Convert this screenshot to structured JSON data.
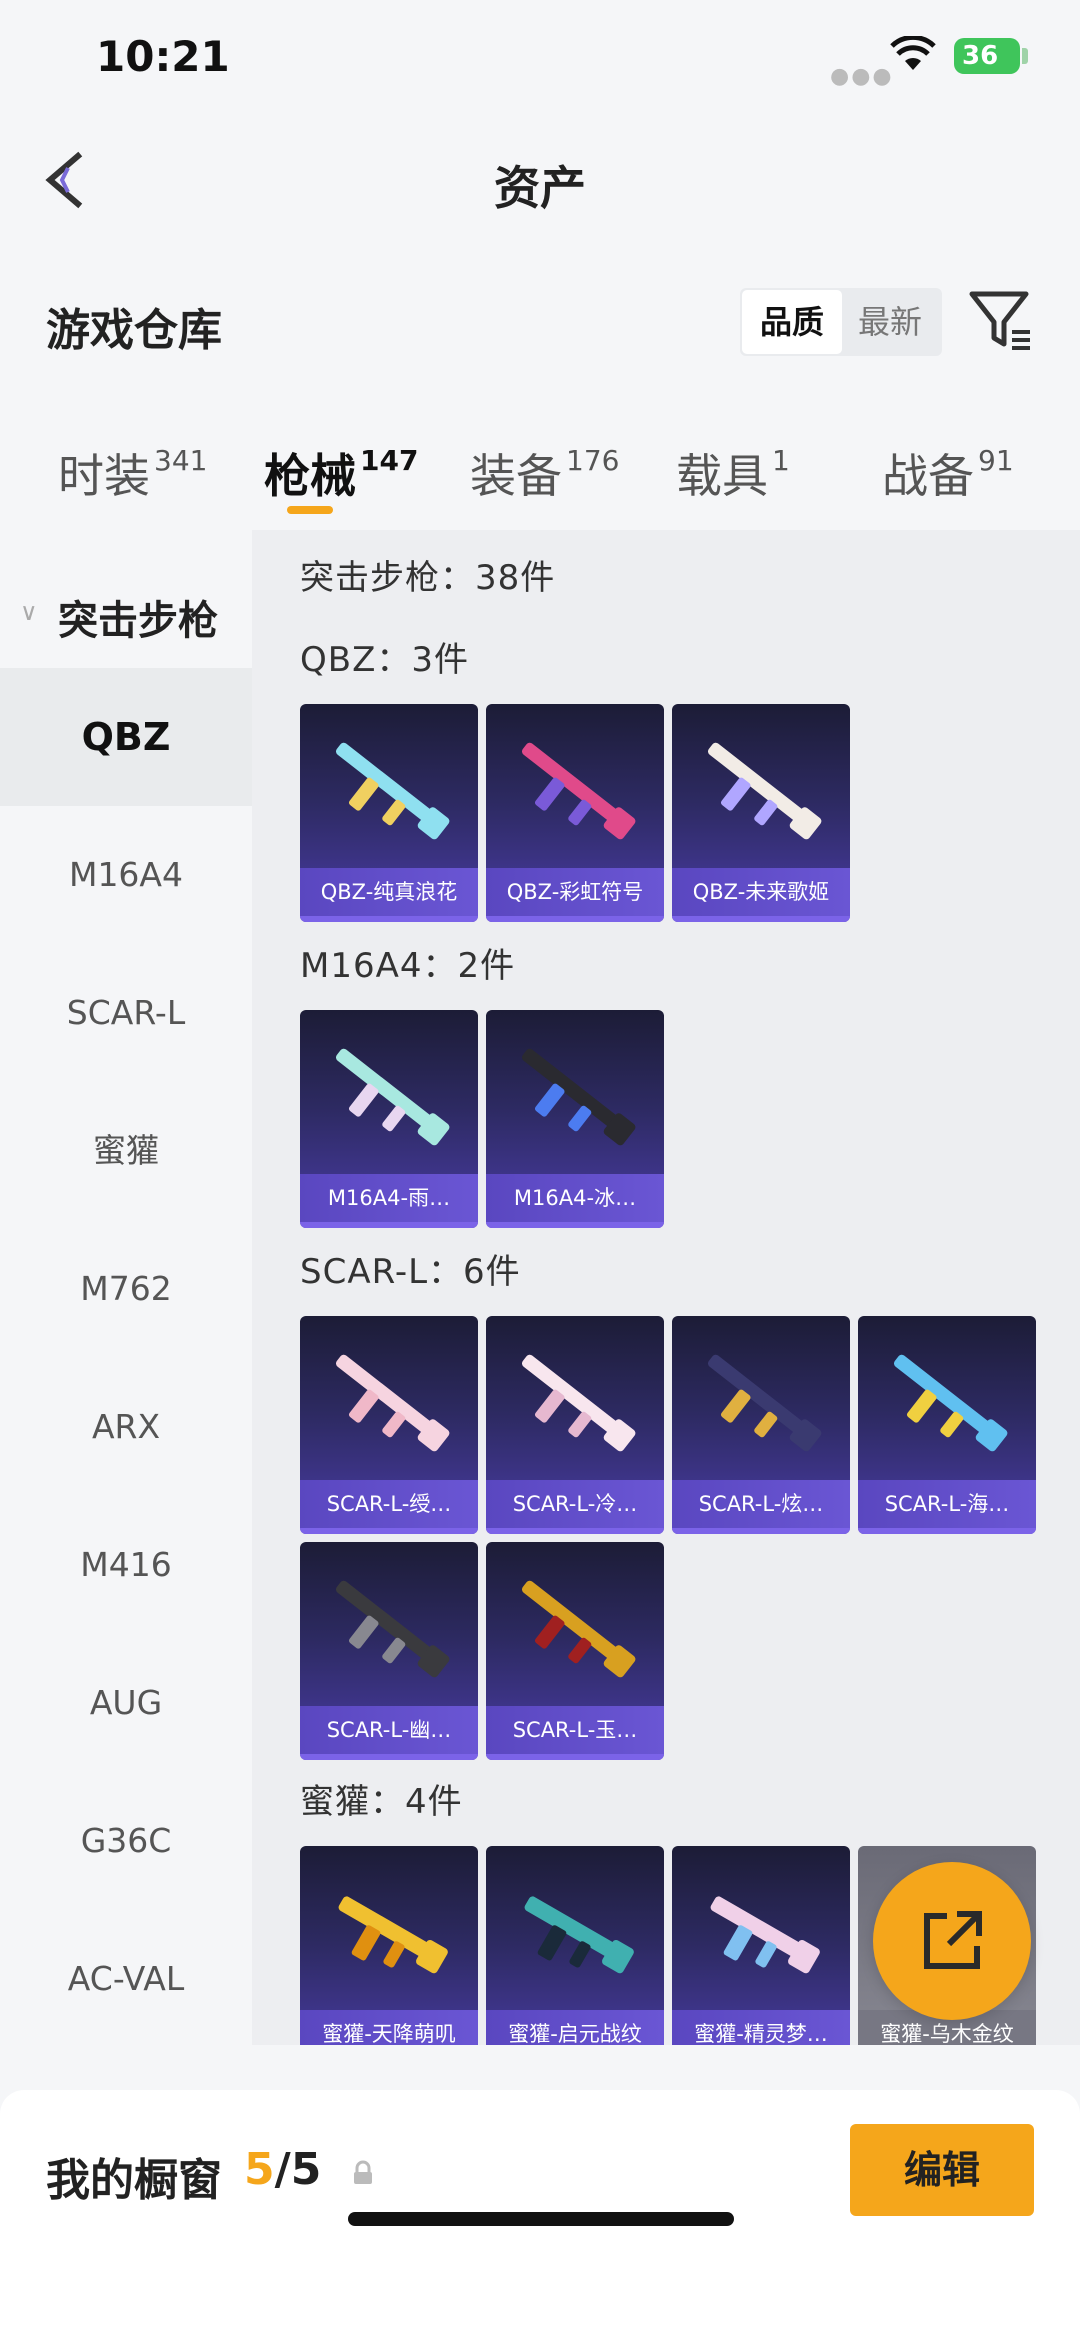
{
  "status": {
    "time": "10:21",
    "battery": "36"
  },
  "nav": {
    "title": "资产"
  },
  "header": {
    "title": "游戏仓库",
    "sort_options": [
      "品质",
      "最新"
    ],
    "sort_selected": "品质"
  },
  "tabs": [
    {
      "label": "时装",
      "count": "341",
      "active": false
    },
    {
      "label": "枪械",
      "count": "147",
      "active": true
    },
    {
      "label": "装备",
      "count": "176",
      "active": false
    },
    {
      "label": "载具",
      "count": "1",
      "active": false
    },
    {
      "label": "战备",
      "count": "91",
      "active": false
    }
  ],
  "sidebar": {
    "category": "突击步枪",
    "items": [
      "QBZ",
      "M16A4",
      "SCAR-L",
      "蜜獾",
      "M762",
      "ARX",
      "M416",
      "AUG",
      "G36C",
      "AC-VAL"
    ],
    "selected": "QBZ"
  },
  "content": {
    "summary": "突击步枪：38件",
    "groups": [
      {
        "title": "QBZ：3件",
        "items": [
          {
            "name": "QBZ-纯真浪花",
            "c1": "#8fe0f0",
            "c2": "#f0d060"
          },
          {
            "name": "QBZ-彩虹符号",
            "c1": "#e04a8a",
            "c2": "#7a5ad8"
          },
          {
            "name": "QBZ-未来歌姬",
            "c1": "#f2ece6",
            "c2": "#b0a6ff"
          }
        ]
      },
      {
        "title": "M16A4：2件",
        "items": [
          {
            "name": "M16A4-雨…",
            "c1": "#a8e8e0",
            "c2": "#e8d6f0"
          },
          {
            "name": "M16A4-冰…",
            "c1": "#2a2a30",
            "c2": "#4c7cf0"
          }
        ]
      },
      {
        "title": "SCAR-L：6件",
        "items": [
          {
            "name": "SCAR-L-绶…",
            "c1": "#f6d4e0",
            "c2": "#f0b8c8"
          },
          {
            "name": "SCAR-L-冷…",
            "c1": "#f8e6ee",
            "c2": "#e6b8d0"
          },
          {
            "name": "SCAR-L-炫…",
            "c1": "#3a3a70",
            "c2": "#e0b040"
          },
          {
            "name": "SCAR-L-海…",
            "c1": "#60c0f0",
            "c2": "#f0d040"
          },
          {
            "name": "SCAR-L-幽…",
            "c1": "#3a3a3e",
            "c2": "#888890"
          },
          {
            "name": "SCAR-L-玉…",
            "c1": "#d8a020",
            "c2": "#a02020"
          }
        ]
      },
      {
        "title": "蜜獾：4件",
        "items": [
          {
            "name": "蜜獾-天降萌叽",
            "c1": "#f0c030",
            "c2": "#e09010",
            "grey": false
          },
          {
            "name": "蜜獾-启元战纹",
            "c1": "#40b0b0",
            "c2": "#1a2a3a",
            "grey": false
          },
          {
            "name": "蜜獾-精灵梦…",
            "c1": "#f0d0e8",
            "c2": "#80c0f0",
            "grey": false
          },
          {
            "name": "蜜獾-乌木金纹",
            "c1": "#3a3a3a",
            "c2": "#c09030",
            "grey": true
          }
        ]
      }
    ]
  },
  "showcase": {
    "label": "我的橱窗",
    "current": "5",
    "total": "/5",
    "edit_label": "编辑"
  },
  "colors": {
    "accent": "#f5a61b",
    "card_bg": "#2d2a62",
    "card_band": "#6a56d4"
  }
}
